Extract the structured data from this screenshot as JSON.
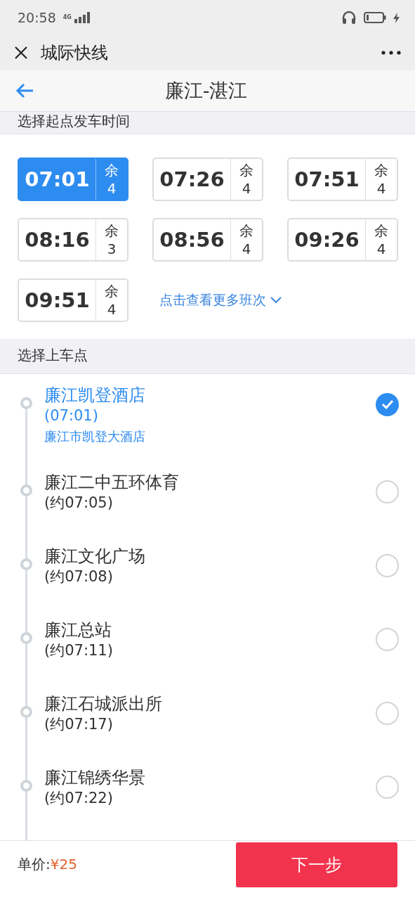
{
  "status_bar": {
    "time": "20:58",
    "network": "4G"
  },
  "app_bar": {
    "title": "城际快线"
  },
  "header": {
    "title": "廉江-湛江"
  },
  "departure_section": {
    "title": "选择起点发车时间",
    "times": [
      {
        "time": "07:01",
        "remain_label": "余",
        "remain": "4",
        "selected": true
      },
      {
        "time": "07:26",
        "remain_label": "余",
        "remain": "4",
        "selected": false
      },
      {
        "time": "07:51",
        "remain_label": "余",
        "remain": "4",
        "selected": false
      },
      {
        "time": "08:16",
        "remain_label": "余",
        "remain": "3",
        "selected": false
      },
      {
        "time": "08:56",
        "remain_label": "余",
        "remain": "4",
        "selected": false
      },
      {
        "time": "09:26",
        "remain_label": "余",
        "remain": "4",
        "selected": false
      },
      {
        "time": "09:51",
        "remain_label": "余",
        "remain": "4",
        "selected": false
      }
    ],
    "more_link": "点击查看更多班次"
  },
  "boarding_section": {
    "title": "选择上车点",
    "stops": [
      {
        "name": "廉江凯登酒店",
        "time": "(07:01)",
        "address": "廉江市凯登大酒店",
        "selected": true
      },
      {
        "name": "廉江二中五环体育",
        "time": "(约07:05)",
        "selected": false
      },
      {
        "name": "廉江文化广场",
        "time": "(约07:08)",
        "selected": false
      },
      {
        "name": "廉江总站",
        "time": "(约07:11)",
        "selected": false
      },
      {
        "name": "廉江石城派出所",
        "time": "(约07:17)",
        "selected": false
      },
      {
        "name": "廉江锦绣华景",
        "time": "(约07:22)",
        "selected": false
      }
    ]
  },
  "footer": {
    "price_label": "单价:",
    "price": "¥25",
    "next_button": "下一步"
  }
}
